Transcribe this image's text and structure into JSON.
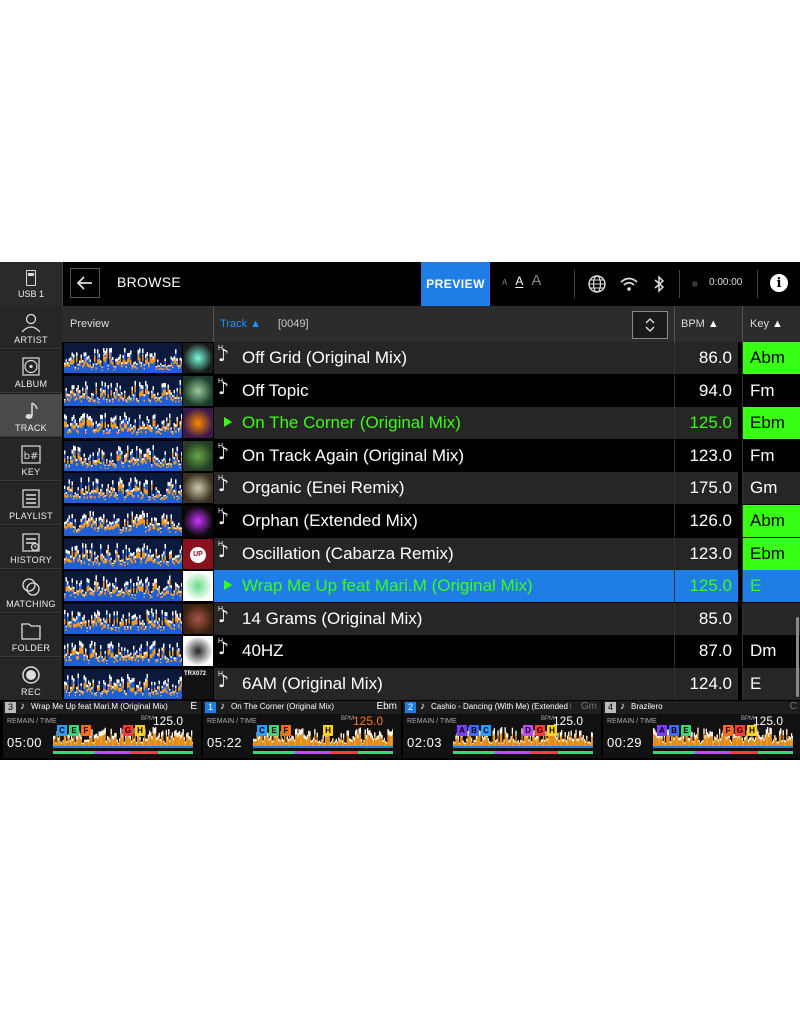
{
  "top_bar": {
    "source_label": "USB 1",
    "title": "BROWSE",
    "preview_label": "PREVIEW",
    "font_sizes": [
      "A",
      "A",
      "A"
    ],
    "clock": "0:00:00"
  },
  "sidebar": {
    "items": [
      {
        "label": "ARTIST",
        "icon": "person-icon"
      },
      {
        "label": "ALBUM",
        "icon": "disc-icon"
      },
      {
        "label": "TRACK",
        "icon": "music-note-icon",
        "active": true
      },
      {
        "label": "KEY",
        "icon": "key-icon",
        "glyph": "b#"
      },
      {
        "label": "PLAYLIST",
        "icon": "playlist-icon"
      },
      {
        "label": "HISTORY",
        "icon": "history-icon"
      },
      {
        "label": "MATCHING",
        "icon": "matching-icon"
      },
      {
        "label": "FOLDER",
        "icon": "folder-icon"
      },
      {
        "label": "REC",
        "icon": "rec-icon"
      }
    ]
  },
  "header": {
    "preview": "Preview",
    "track": "Track",
    "count": "[0049]",
    "bpm": "BPM",
    "key": "Key"
  },
  "tracks": [
    {
      "title": "Off Grid (Original Mix)",
      "bpm": "86.0",
      "key": "Abm",
      "key_highlight": true,
      "state": "normal",
      "bg": "dark"
    },
    {
      "title": "Off Topic",
      "bpm": "94.0",
      "key": "Fm",
      "key_highlight": false,
      "state": "normal",
      "bg": "black"
    },
    {
      "title": "On The Corner (Original Mix)",
      "bpm": "125.0",
      "key": "Ebm",
      "key_highlight": true,
      "state": "playing",
      "bg": "dark"
    },
    {
      "title": "On Track Again (Original Mix)",
      "bpm": "123.0",
      "key": "Fm",
      "key_highlight": false,
      "state": "normal",
      "bg": "black"
    },
    {
      "title": "Organic (Enei Remix)",
      "bpm": "175.0",
      "key": "Gm",
      "key_highlight": false,
      "state": "normal",
      "bg": "dark"
    },
    {
      "title": "Orphan (Extended Mix)",
      "bpm": "126.0",
      "key": "Abm",
      "key_highlight": true,
      "state": "normal",
      "bg": "black"
    },
    {
      "title": "Oscillation (Cabarza Remix)",
      "bpm": "123.0",
      "key": "Ebm",
      "key_highlight": true,
      "state": "normal",
      "bg": "dark"
    },
    {
      "title": "Wrap Me Up feat Mari.M (Original Mix)",
      "bpm": "125.0",
      "key": "E",
      "key_highlight": false,
      "state": "selected",
      "bg": "blue"
    },
    {
      "title": "14 Grams (Original Mix)",
      "bpm": "85.0",
      "key": "",
      "key_highlight": false,
      "state": "normal",
      "bg": "dark"
    },
    {
      "title": "40HZ",
      "bpm": "87.0",
      "key": "Dm",
      "key_highlight": false,
      "state": "normal",
      "bg": "black"
    },
    {
      "title": "6AM (Original Mix)",
      "bpm": "124.0",
      "key": "E",
      "key_highlight": false,
      "state": "normal",
      "bg": "dark"
    }
  ],
  "artwork_texts": [
    "UP",
    "TRX072"
  ],
  "decks": [
    {
      "number": "3",
      "title": "Wrap Me Up feat Mari.M (Original Mix)",
      "key": "E",
      "remain_label": "REMAIN / TIME",
      "time": "05:00",
      "bpm_label": "BPM",
      "bpm": "125.0",
      "bpm_color": "white",
      "cues": [
        "C",
        "E",
        "F",
        "G",
        "H"
      ],
      "num_color": "grey",
      "key_dim": false
    },
    {
      "number": "1",
      "title": "On The Corner (Original Mix)",
      "key": "Ebm",
      "remain_label": "REMAIN / TIME",
      "time": "05:22",
      "bpm_label": "BPM",
      "bpm": "125.0",
      "bpm_color": "orange",
      "cues": [
        "C",
        "E",
        "F",
        "H"
      ],
      "num_color": "blue",
      "key_dim": false
    },
    {
      "number": "2",
      "title": "Cashio - Dancing (With Me) (Extended Mix)",
      "key": "Gm",
      "remain_label": "REMAIN / TIME",
      "time": "02:03",
      "bpm_label": "BPM",
      "bpm": "125.0",
      "bpm_color": "white",
      "cues": [
        "A",
        "B",
        "C",
        "D",
        "G",
        "H"
      ],
      "num_color": "blue",
      "key_dim": true
    },
    {
      "number": "4",
      "title": "Brazilero",
      "key": "C",
      "remain_label": "REMAIN / TIME",
      "time": "00:29",
      "bpm_label": "BPM",
      "bpm": "125.0",
      "bpm_color": "white",
      "cues": [
        "A",
        "B",
        "E",
        "F",
        "G",
        "H"
      ],
      "num_color": "grey",
      "key_dim": true
    }
  ],
  "colors": {
    "accent_blue": "#1e7ee6",
    "key_green": "#39ff14",
    "playing_green": "#39ff14",
    "bpm_orange": "#ff7a1a"
  }
}
